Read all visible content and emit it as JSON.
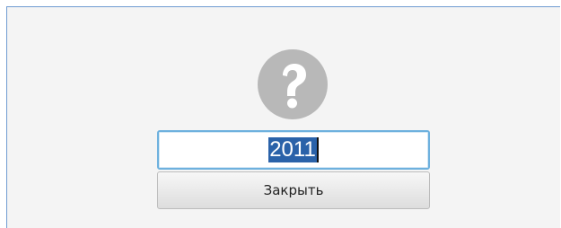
{
  "dialog": {
    "icon": "question-mark-icon",
    "input": {
      "value": "2011"
    },
    "close_label": "Закрыть"
  }
}
